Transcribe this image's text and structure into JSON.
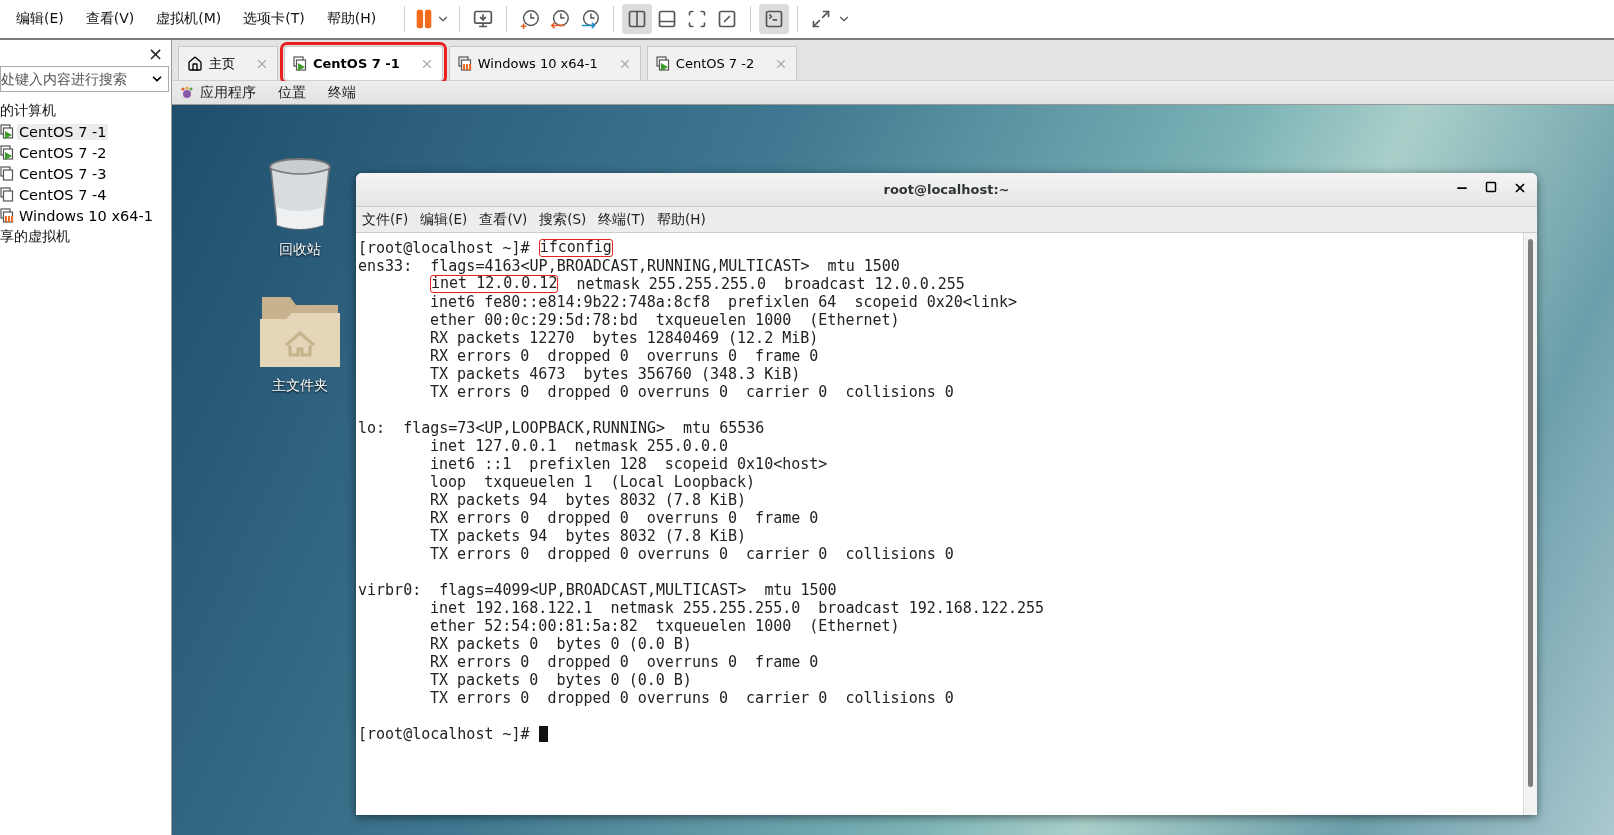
{
  "menu_bar": {
    "items": [
      "编辑(E)",
      "查看(V)",
      "虚拟机(M)",
      "选项卡(T)",
      "帮助(H)"
    ]
  },
  "sidebar": {
    "close": "×",
    "search": {
      "placeholder": "处键入内容进行搜索"
    },
    "tree": [
      {
        "label": "的计算机",
        "children": [
          {
            "label": "CentOS 7 -1",
            "running": true,
            "paused": false,
            "selected": true
          },
          {
            "label": "CentOS 7 -2",
            "running": true,
            "paused": false,
            "selected": false
          },
          {
            "label": "CentOS 7 -3",
            "running": false,
            "paused": false,
            "selected": false
          },
          {
            "label": "CentOS 7 -4",
            "running": false,
            "paused": false,
            "selected": false
          },
          {
            "label": "Windows 10 x64-1",
            "running": false,
            "paused": true,
            "selected": false
          }
        ]
      },
      {
        "label": "享的虚拟机"
      }
    ]
  },
  "tabs": [
    {
      "label": "主页",
      "kind": "home",
      "selected": false,
      "highlighted": false
    },
    {
      "label": "CentOS 7 -1",
      "kind": "vm",
      "running": true,
      "paused": false,
      "selected": true,
      "highlighted": true
    },
    {
      "label": "Windows 10 x64-1",
      "kind": "vm",
      "running": false,
      "paused": true,
      "selected": false,
      "highlighted": false
    },
    {
      "label": "CentOS 7 -2",
      "kind": "vm",
      "running": true,
      "paused": false,
      "selected": false,
      "highlighted": false
    }
  ],
  "guest_bar": {
    "items": [
      "应用程序",
      "位置",
      "终端"
    ]
  },
  "desktop": {
    "icons": [
      {
        "label": "回收站",
        "kind": "trash"
      },
      {
        "label": "主文件夹",
        "kind": "home-folder"
      }
    ]
  },
  "terminal": {
    "title": "root@localhost:~",
    "menu": [
      "文件(F)",
      "编辑(E)",
      "查看(V)",
      "搜索(S)",
      "终端(T)",
      "帮助(H)"
    ],
    "lines": [
      {
        "kind": "text",
        "indented": false,
        "parts": [
          {
            "text": "[root@localhost ~]# "
          },
          {
            "text": "ifconfig",
            "marked": true
          }
        ]
      },
      {
        "kind": "text",
        "indented": false,
        "parts": [
          {
            "text": "ens33:  flags=4163<UP,BROADCAST,RUNNING,MULTICAST>  mtu 1500"
          }
        ]
      },
      {
        "kind": "text",
        "indented": true,
        "parts": [
          {
            "text": "inet 12.0.0.12",
            "marked": true
          },
          {
            "text": "  netmask 255.255.255.0  broadcast 12.0.0.255"
          }
        ]
      },
      {
        "kind": "text",
        "indented": true,
        "parts": [
          {
            "text": "inet6 fe80::e814:9b22:748a:8cf8  prefixlen 64  scopeid 0x20<link>"
          }
        ]
      },
      {
        "kind": "text",
        "indented": true,
        "parts": [
          {
            "text": "ether 00:0c:29:5d:78:bd  txqueuelen 1000  (Ethernet)"
          }
        ]
      },
      {
        "kind": "text",
        "indented": true,
        "parts": [
          {
            "text": "RX packets 12270  bytes 12840469 (12.2 MiB)"
          }
        ]
      },
      {
        "kind": "text",
        "indented": true,
        "parts": [
          {
            "text": "RX errors 0  dropped 0  overruns 0  frame 0"
          }
        ]
      },
      {
        "kind": "text",
        "indented": true,
        "parts": [
          {
            "text": "TX packets 4673  bytes 356760 (348.3 KiB)"
          }
        ]
      },
      {
        "kind": "text",
        "indented": true,
        "parts": [
          {
            "text": "TX errors 0  dropped 0 overruns 0  carrier 0  collisions 0"
          }
        ]
      },
      {
        "kind": "blank"
      },
      {
        "kind": "text",
        "indented": false,
        "parts": [
          {
            "text": "lo:  flags=73<UP,LOOPBACK,RUNNING>  mtu 65536"
          }
        ]
      },
      {
        "kind": "text",
        "indented": true,
        "parts": [
          {
            "text": "inet 127.0.0.1  netmask 255.0.0.0"
          }
        ]
      },
      {
        "kind": "text",
        "indented": true,
        "parts": [
          {
            "text": "inet6 ::1  prefixlen 128  scopeid 0x10<host>"
          }
        ]
      },
      {
        "kind": "text",
        "indented": true,
        "parts": [
          {
            "text": "loop  txqueuelen 1  (Local Loopback)"
          }
        ]
      },
      {
        "kind": "text",
        "indented": true,
        "parts": [
          {
            "text": "RX packets 94  bytes 8032 (7.8 KiB)"
          }
        ]
      },
      {
        "kind": "text",
        "indented": true,
        "parts": [
          {
            "text": "RX errors 0  dropped 0  overruns 0  frame 0"
          }
        ]
      },
      {
        "kind": "text",
        "indented": true,
        "parts": [
          {
            "text": "TX packets 94  bytes 8032 (7.8 KiB)"
          }
        ]
      },
      {
        "kind": "text",
        "indented": true,
        "parts": [
          {
            "text": "TX errors 0  dropped 0 overruns 0  carrier 0  collisions 0"
          }
        ]
      },
      {
        "kind": "blank"
      },
      {
        "kind": "text",
        "indented": false,
        "parts": [
          {
            "text": "virbr0:  flags=4099<UP,BROADCAST,MULTICAST>  mtu 1500"
          }
        ]
      },
      {
        "kind": "text",
        "indented": true,
        "parts": [
          {
            "text": "inet 192.168.122.1  netmask 255.255.255.0  broadcast 192.168.122.255"
          }
        ]
      },
      {
        "kind": "text",
        "indented": true,
        "parts": [
          {
            "text": "ether 52:54:00:81:5a:82  txqueuelen 1000  (Ethernet)"
          }
        ]
      },
      {
        "kind": "text",
        "indented": true,
        "parts": [
          {
            "text": "RX packets 0  bytes 0 (0.0 B)"
          }
        ]
      },
      {
        "kind": "text",
        "indented": true,
        "parts": [
          {
            "text": "RX errors 0  dropped 0  overruns 0  frame 0"
          }
        ]
      },
      {
        "kind": "text",
        "indented": true,
        "parts": [
          {
            "text": "TX packets 0  bytes 0 (0.0 B)"
          }
        ]
      },
      {
        "kind": "text",
        "indented": true,
        "parts": [
          {
            "text": "TX errors 0  dropped 0 overruns 0  carrier 0  collisions 0"
          }
        ]
      },
      {
        "kind": "blank"
      },
      {
        "kind": "text",
        "indented": false,
        "parts": [
          {
            "text": "[root@localhost ~]# "
          },
          {
            "kind": "cursor"
          }
        ]
      }
    ]
  }
}
